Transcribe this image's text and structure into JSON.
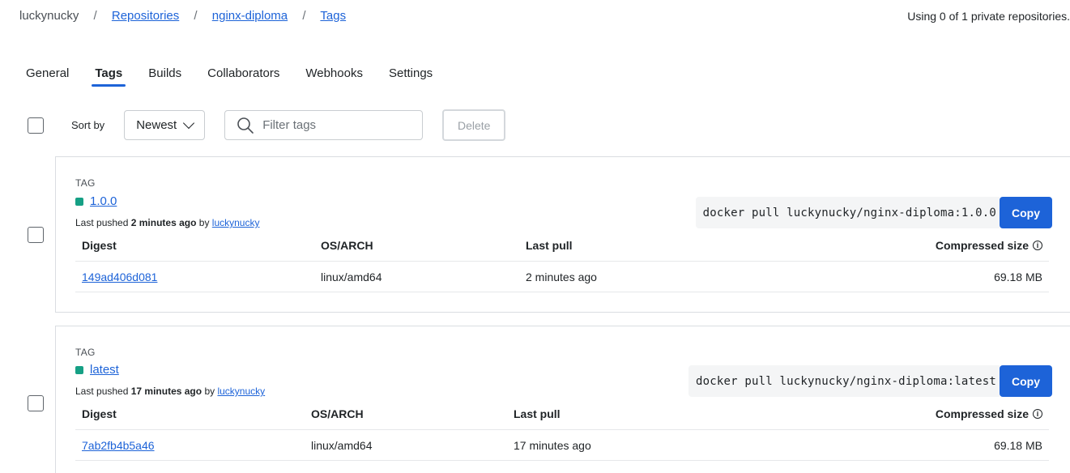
{
  "breadcrumb": {
    "owner": "luckynucky",
    "repositories": "Repositories",
    "repo": "nginx-diploma",
    "section": "Tags",
    "separator": "/"
  },
  "usage_text": "Using 0 of 1 private repositories.",
  "tabs": [
    {
      "label": "General",
      "active": false
    },
    {
      "label": "Tags",
      "active": true
    },
    {
      "label": "Builds",
      "active": false
    },
    {
      "label": "Collaborators",
      "active": false
    },
    {
      "label": "Webhooks",
      "active": false
    },
    {
      "label": "Settings",
      "active": false
    }
  ],
  "toolbar": {
    "sort_label": "Sort by",
    "sort_value": "Newest",
    "filter_placeholder": "Filter tags",
    "delete_label": "Delete"
  },
  "columns": {
    "digest": "Digest",
    "os_arch": "OS/ARCH",
    "last_pull": "Last pull",
    "compressed_size": "Compressed size"
  },
  "tags": [
    {
      "tag_label": "TAG",
      "name": "1.0.0",
      "pushed_prefix": "Last pushed",
      "pushed_when": "2 minutes ago",
      "pushed_by_prefix": "by",
      "pushed_by": "luckynucky",
      "pull_command": "docker pull luckynucky/nginx-diploma:1.0.0",
      "copy_label": "Copy",
      "digest": "149ad406d081",
      "os_arch": "linux/amd64",
      "last_pull": "2 minutes ago",
      "size": "69.18 MB"
    },
    {
      "tag_label": "TAG",
      "name": "latest",
      "pushed_prefix": "Last pushed",
      "pushed_when": "17 minutes ago",
      "pushed_by_prefix": "by",
      "pushed_by": "luckynucky",
      "pull_command": "docker pull luckynucky/nginx-diploma:latest",
      "copy_label": "Copy",
      "digest": "7ab2fb4b5a46",
      "os_arch": "linux/amd64",
      "last_pull": "17 minutes ago",
      "size": "69.18 MB"
    }
  ],
  "icons": {
    "search": "search-icon",
    "chevron": "chevron-down-icon",
    "info": "info-icon"
  },
  "colors": {
    "accent": "#1d63d8",
    "status_dot": "#16a085"
  }
}
